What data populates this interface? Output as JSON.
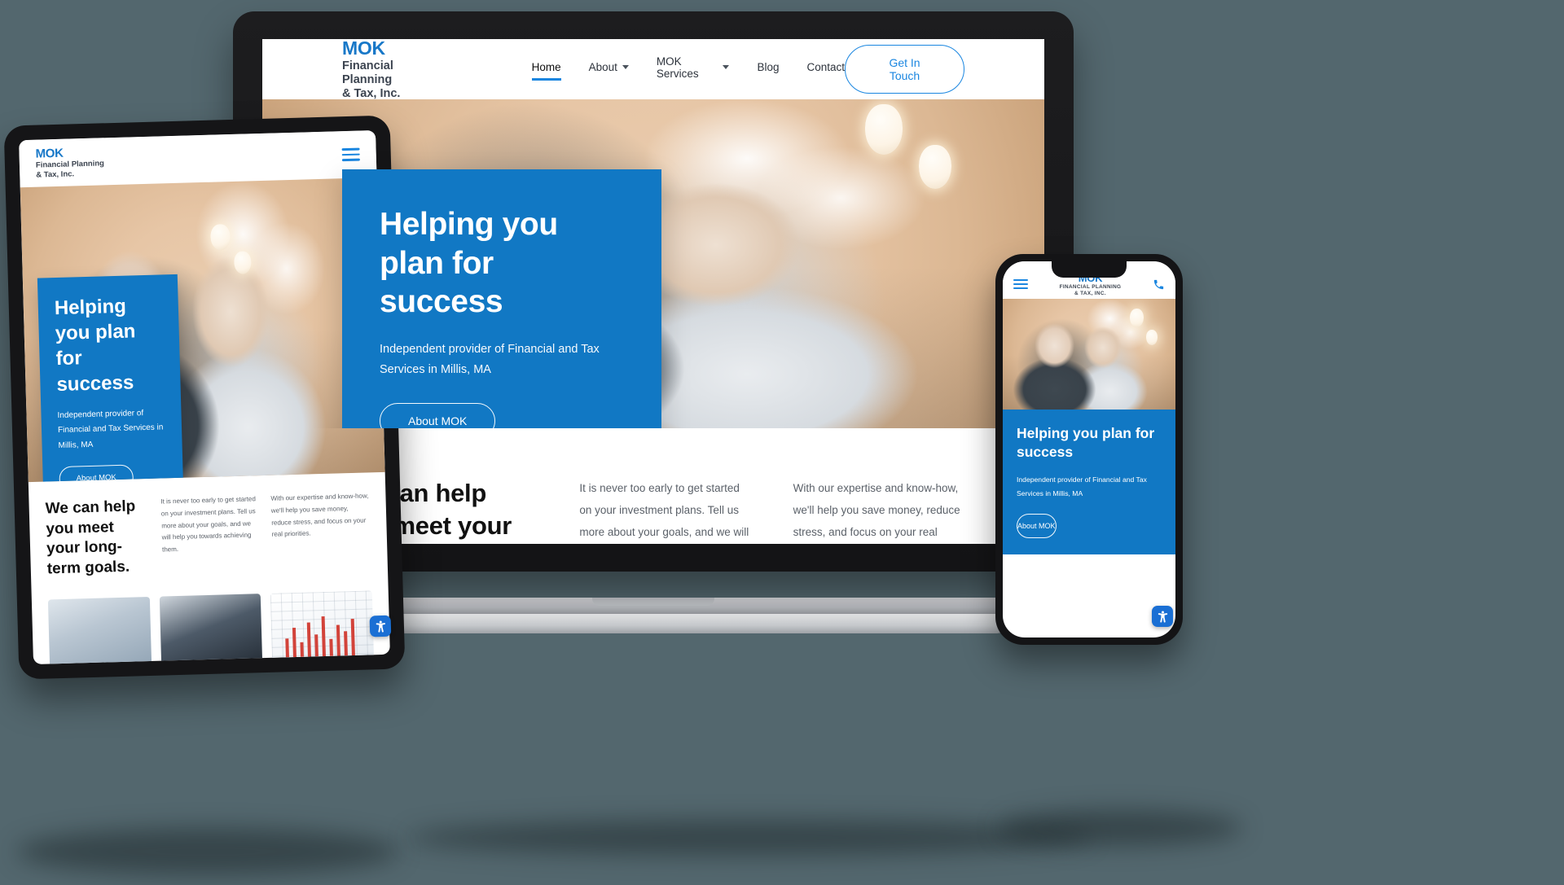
{
  "brand": {
    "name": "MOK",
    "tagline_line1": "Financial Planning",
    "tagline_line2": "& Tax, Inc.",
    "tagline_line1_upper": "FINANCIAL PLANNING",
    "tagline_line2_upper": "& TAX, INC.",
    "accent_color": "#1878c8",
    "hero_blue": "#1178c4",
    "link_blue": "#1a86e0"
  },
  "desktop": {
    "nav": {
      "items": [
        {
          "label": "Home",
          "has_dropdown": false,
          "active": true
        },
        {
          "label": "About",
          "has_dropdown": true,
          "active": false
        },
        {
          "label": "MOK Services",
          "has_dropdown": true,
          "active": false
        },
        {
          "label": "Blog",
          "has_dropdown": false,
          "active": false
        },
        {
          "label": "Contact",
          "has_dropdown": false,
          "active": false
        }
      ],
      "cta_label": "Get In Touch"
    },
    "hero": {
      "heading": "Helping you plan for success",
      "subheading": "Independent provider of Financial and Tax Services in Millis, MA",
      "button_label": "About MOK"
    },
    "section": {
      "heading": "We can help you meet your long-term goals.",
      "paragraph_1": "It is never too early to get started on your investment plans. Tell us more about your goals, and we will help you towards achieving them.",
      "paragraph_2": "With our expertise and know-how, we'll help you save money, reduce stress, and focus on your real priorities."
    }
  },
  "tablet": {
    "nav": {
      "menu_icon": "hamburger-icon"
    },
    "hero": {
      "heading": "Helping you plan for success",
      "subheading": "Independent provider of Financial and Tax Services in Millis, MA",
      "button_label": "About MOK"
    },
    "section": {
      "heading": "We can help you meet your long-term goals.",
      "paragraph_1": "It is never too early to get started on your investment plans. Tell us more about your goals, and we will help you towards achieving them.",
      "paragraph_2": "With our expertise and know-how, we'll help you save money, reduce stress, and focus on your real priorities."
    },
    "accessibility_button": "accessibility-icon"
  },
  "phone": {
    "nav": {
      "menu_icon": "hamburger-icon",
      "call_icon": "phone-icon"
    },
    "hero": {
      "heading": "Helping you plan for success",
      "subheading": "Independent provider of Financial and Tax Services in Millis, MA",
      "button_label": "About MOK"
    },
    "accessibility_button": "accessibility-icon"
  }
}
